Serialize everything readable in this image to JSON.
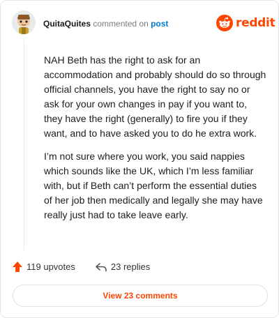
{
  "header": {
    "username": "QuitaQuites",
    "action_text": "commented on",
    "post_link": "post"
  },
  "brand": {
    "wordmark": "reddit",
    "color": "#ff4500",
    "icon": "reddit-logo-icon"
  },
  "comment": {
    "paragraphs": [
      "NAH Beth has the right to ask for an accommodation and probably should do so through official channels, you have the right to say no or ask for your own changes in pay if you want to, they have the right (generally) to fire you if they want, and to have asked you to do he extra work.",
      "I’m not sure where you work, you said nappies which sounds like the UK, which I’m less familiar with, but if Beth can’t perform the essential duties of her job then medically and legally she may have really just had to take leave early."
    ]
  },
  "stats": {
    "upvotes": "119 upvotes",
    "replies": "23 replies",
    "upvote_icon": "upvote-arrow-icon",
    "reply_icon": "reply-arrow-icon"
  },
  "footer": {
    "view_comments_label": "View 23 comments"
  }
}
